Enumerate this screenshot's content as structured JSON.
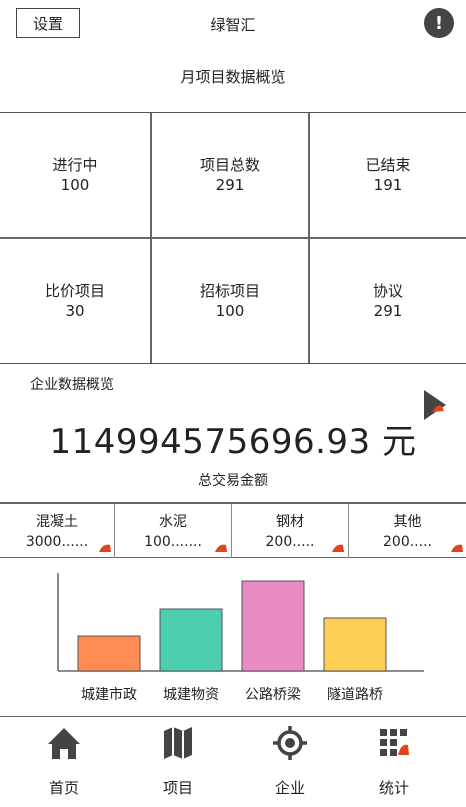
{
  "header": {
    "settings_label": "设置",
    "app_title": "绿智汇",
    "alert_icon": "exclamation-circle-icon"
  },
  "overview": {
    "title": "月项目数据概览"
  },
  "stats": [
    {
      "label": "进行中",
      "value": "100"
    },
    {
      "label": "项目总数",
      "value": "291"
    },
    {
      "label": "已结束",
      "value": "191"
    },
    {
      "label": "比价项目",
      "value": "30"
    },
    {
      "label": "招标项目",
      "value": "100"
    },
    {
      "label": "协议",
      "value": "291"
    }
  ],
  "enterprise": {
    "title": "企业数据概览",
    "amount": "114994575696.93 元",
    "caption": "总交易金额",
    "arrow_icon": "play-icon"
  },
  "materials": [
    {
      "name": "混凝土",
      "value": "3000......"
    },
    {
      "name": "水泥",
      "value": "100......."
    },
    {
      "name": "钢材",
      "value": "200....."
    },
    {
      "name": "其他",
      "value": "200....."
    }
  ],
  "chart_data": {
    "type": "bar",
    "categories": [
      "城建市政",
      "城建物资",
      "公路桥梁",
      "隧道路桥"
    ],
    "values": [
      35,
      62,
      90,
      53
    ],
    "ylim": [
      0,
      100
    ],
    "colors": [
      "#FF8C55",
      "#4DCFAE",
      "#E98BC4",
      "#FFCF55"
    ]
  },
  "nav": [
    {
      "label": "首页",
      "icon": "home-icon"
    },
    {
      "label": "项目",
      "icon": "map-icon"
    },
    {
      "label": "企业",
      "icon": "target-icon"
    },
    {
      "label": "统计",
      "icon": "grid-chart-icon"
    }
  ],
  "accent_color": "#E0441A"
}
